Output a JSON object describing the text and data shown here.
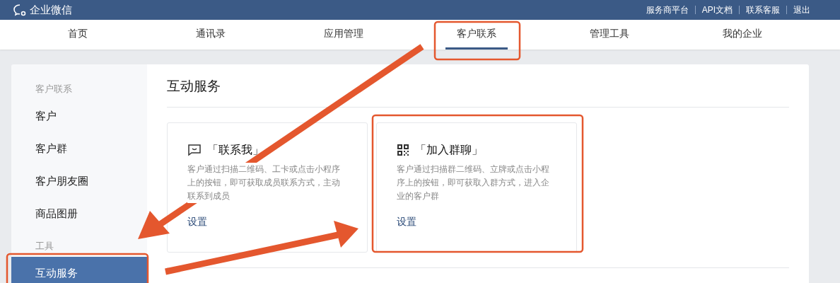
{
  "header": {
    "brand": "企业微信",
    "links": [
      "服务商平台",
      "API文档",
      "联系客服",
      "退出"
    ]
  },
  "nav": [
    {
      "label": "首页",
      "selected": false
    },
    {
      "label": "通讯录",
      "selected": false
    },
    {
      "label": "应用管理",
      "selected": false
    },
    {
      "label": "客户联系",
      "selected": true
    },
    {
      "label": "管理工具",
      "selected": false
    },
    {
      "label": "我的企业",
      "selected": false
    }
  ],
  "sidebar": [
    {
      "kind": "heading",
      "label": "客户联系"
    },
    {
      "kind": "item",
      "label": "客户",
      "selected": false
    },
    {
      "kind": "item",
      "label": "客户群",
      "selected": false
    },
    {
      "kind": "item",
      "label": "客户朋友圈",
      "selected": false
    },
    {
      "kind": "item",
      "label": "商品图册",
      "selected": false
    },
    {
      "kind": "heading",
      "label": "工具"
    },
    {
      "kind": "item",
      "label": "互动服务",
      "selected": true
    }
  ],
  "content": {
    "title": "互动服务",
    "cards": [
      {
        "kind": "message",
        "title": "「联系我」",
        "description": "客户通过扫描二维码、工卡或点击小程序上的按钮，即可获取成员联系方式，主动联系到成员",
        "action": "设置"
      },
      {
        "kind": "qr",
        "title": "「加入群聊」",
        "description": "客户通过扫描群二维码、立牌或点击小程序上的按钮，即可获取入群方式，进入企业的客户群",
        "action": "设置"
      }
    ]
  }
}
